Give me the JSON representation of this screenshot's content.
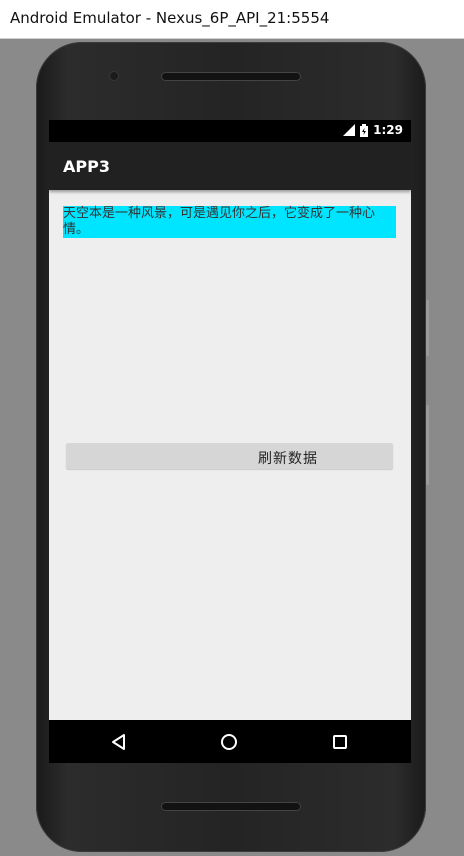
{
  "window": {
    "title": "Android Emulator - Nexus_6P_API_21:5554"
  },
  "status_bar": {
    "time": "1:29",
    "icons": [
      "signal-icon",
      "battery-icon"
    ]
  },
  "action_bar": {
    "title": "APP3"
  },
  "content": {
    "text": "天空本是一种风景，可是遇见你之后，它变成了一种心情。",
    "text_background": "#00e5ff"
  },
  "refresh_button": {
    "label": "刷新数据"
  },
  "nav_bar": {
    "buttons": [
      "back-icon",
      "home-icon",
      "recents-icon"
    ]
  }
}
